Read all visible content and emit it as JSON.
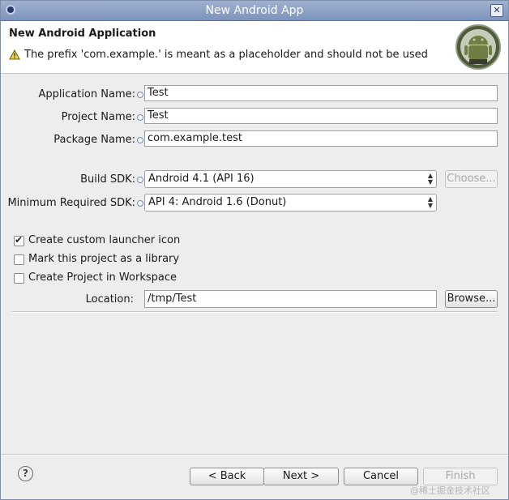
{
  "window": {
    "title": "New Android App",
    "close_glyph": "✕"
  },
  "header": {
    "title": "New Android Application",
    "message": "The prefix 'com.example.' is meant as a placeholder and should not be used",
    "warning_icon": "warning-triangle-icon",
    "logo_icon": "android-logo-icon"
  },
  "form": {
    "app_name_label": "Application Name:",
    "app_name_value": "Test",
    "project_name_label": "Project Name:",
    "project_name_value": "Test",
    "package_name_label": "Package Name:",
    "package_name_value": "com.example.test",
    "build_sdk_label": "Build SDK:",
    "build_sdk_value": "Android 4.1 (API 16)",
    "choose_label": "Choose...",
    "min_sdk_label": "Minimum Required SDK:",
    "min_sdk_value": "API 4: Android 1.6 (Donut)"
  },
  "options": {
    "launcher_icon": {
      "label": "Create custom launcher icon",
      "checked": true
    },
    "library": {
      "label": "Mark this project as a library",
      "checked": false
    },
    "workspace": {
      "label": "Create Project in Workspace",
      "checked": false
    }
  },
  "location": {
    "label": "Location:",
    "value": "/tmp/Test",
    "browse_label": "Browse..."
  },
  "footer": {
    "help_glyph": "?",
    "back_label": "< Back",
    "next_label": "Next >",
    "cancel_label": "Cancel",
    "finish_label": "Finish"
  },
  "watermark": "@稀土掘金技术社区"
}
